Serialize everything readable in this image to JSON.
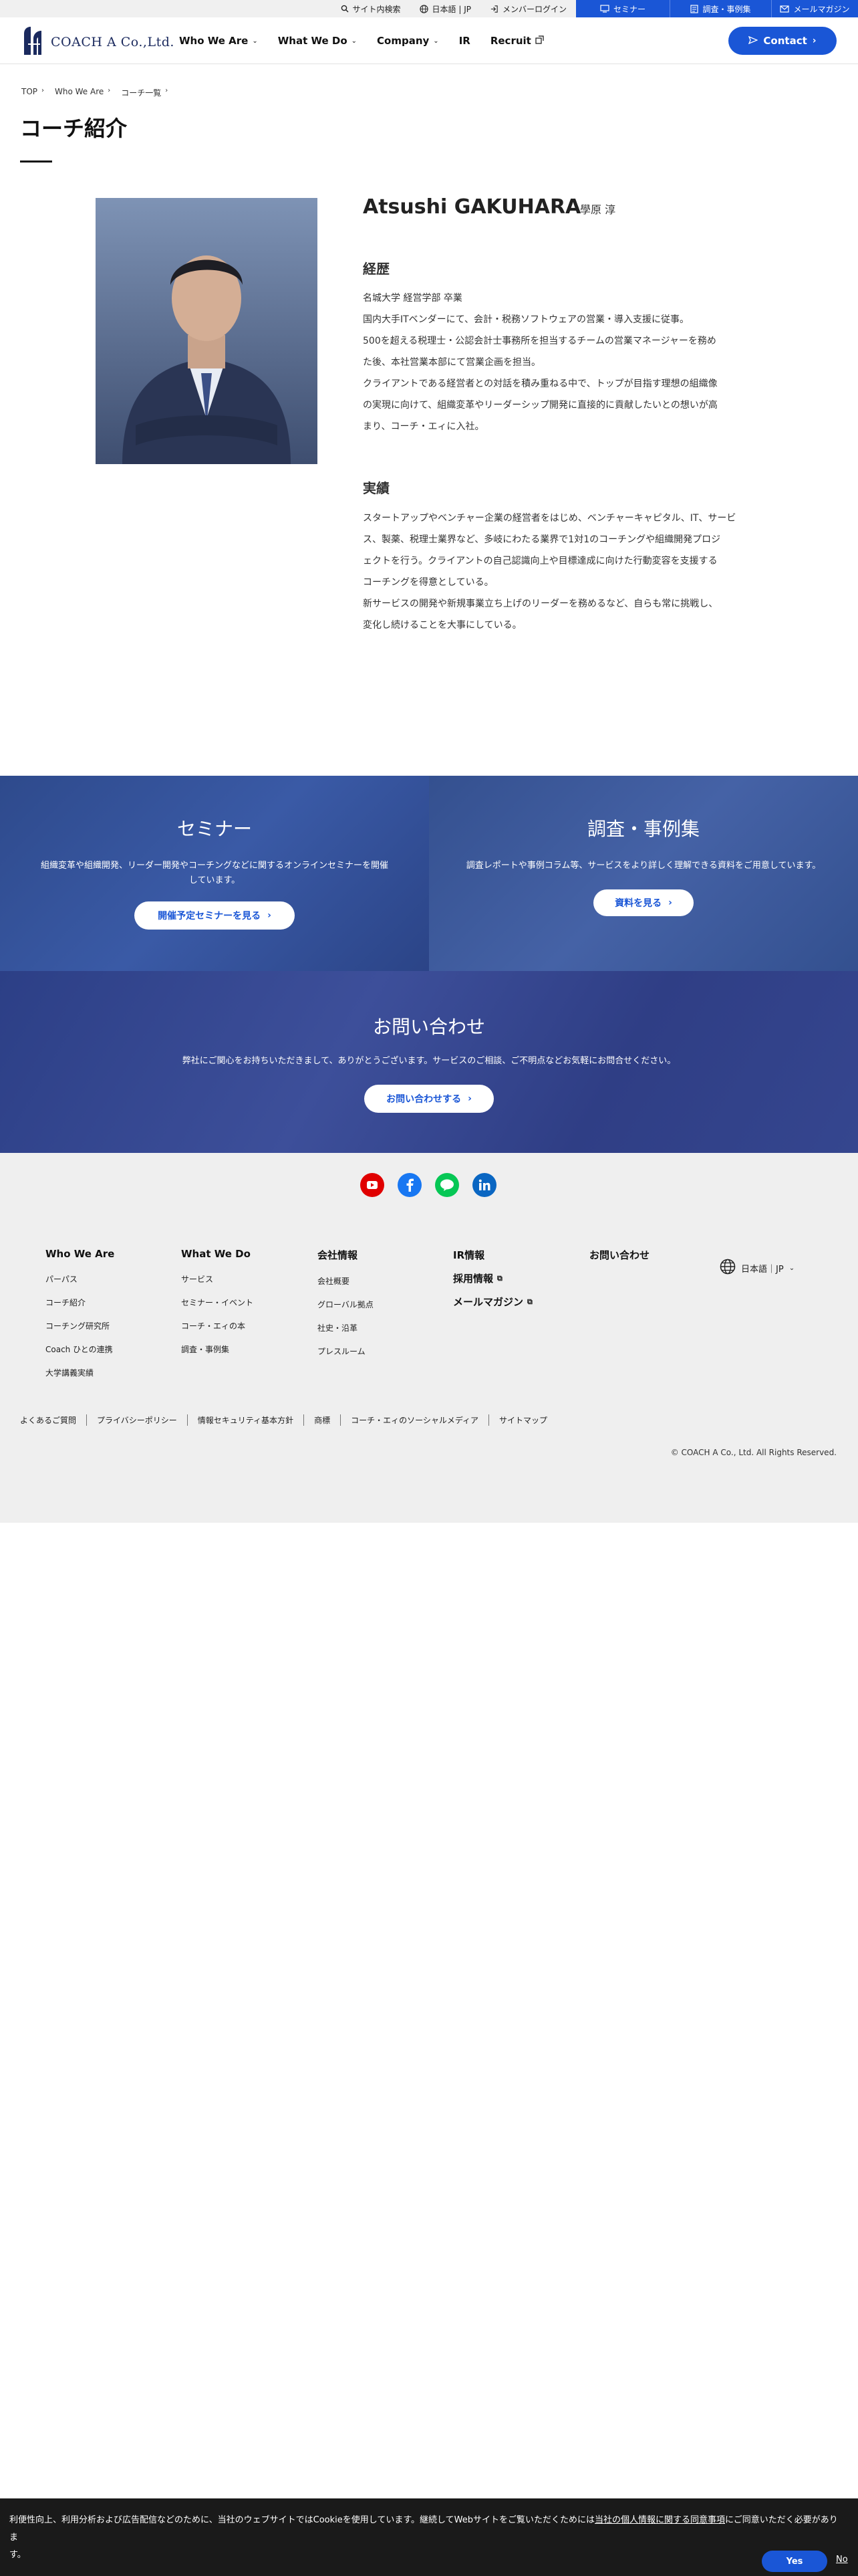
{
  "utility": {
    "search": "サイト内検索",
    "language": "日本語 | JP",
    "login": "メンバーログイン",
    "seminar": "セミナー",
    "research": "調査・事例集",
    "mail": "メールマガジン"
  },
  "header": {
    "logo_text": "COACH A Co.,Ltd.",
    "nav": [
      "Who We Are",
      "What We Do",
      "Company",
      "IR",
      "Recruit"
    ],
    "contact": "Contact"
  },
  "breadcrumb": [
    "TOP",
    "Who We Are",
    "コーチ一覧"
  ],
  "page_title": "コーチ紹介",
  "profile": {
    "name": "Atsushi GAKUHARA",
    "kanji_name": "學原 淳",
    "career_title": "経歴",
    "career_lines": [
      "名城大学 経営学部 卒業",
      "国内大手ITベンダーにて、会計・税務ソフトウェアの営業・導入支援に従事。",
      "500を超える税理士・公認会計士事務所を担当するチームの営業マネージャーを務め",
      "た後、本社営業本部にて営業企画を担当。",
      "クライアントである経営者との対話を積み重ねる中で、トップが目指す理想の組織像",
      "の実現に向けて、組織変革やリーダーシップ開発に直接的に貢献したいとの想いが高",
      "まり、コーチ・エィに入社。"
    ],
    "achievements_title": "実績",
    "achievement_lines": [
      "スタートアップやベンチャー企業の経営者をはじめ、ベンチャーキャピタル、IT、サービ",
      "ス、製薬、税理士業界など、多岐にわたる業界で1対1のコーチングや組織開発プロジ",
      "ェクトを行う。クライアントの自己認識向上や目標達成に向けた行動変容を支援する",
      "コーチングを得意としている。",
      "新サービスの開発や新規事業立ち上げのリーダーを務めるなど、自らも常に挑戦し、",
      "変化し続けることを大事にしている。"
    ]
  },
  "banners": {
    "seminar": {
      "title": "セミナー",
      "desc_line1": "組織変革や組織開発、リーダー開発やコーチングなどに関するオンラインセミナーを開催",
      "desc_line2": "しています。",
      "button": "開催予定セミナーを見る"
    },
    "research": {
      "title": "調査・事例集",
      "desc": "調査レポートや事例コラム等、サービスをより詳しく理解できる資料をご用意しています。",
      "button": "資料を見る"
    },
    "contact": {
      "title": "お問い合わせ",
      "desc": "弊社にご関心をお持ちいただきまして、ありがとうございます。サービスのご相談、ご不明点などお気軽にお問合せください。",
      "button": "お問い合わせする"
    }
  },
  "footer": {
    "social": [
      "youtube-icon",
      "facebook-icon",
      "line-icon",
      "linkedin-icon"
    ],
    "col1": {
      "title": "Who We Are",
      "items": [
        "パーパス",
        "コーチ紹介",
        "コーチング研究所",
        "Coach ひとの連携",
        "大学講義実績"
      ]
    },
    "col2": {
      "title": "What We Do",
      "items": [
        "サービス",
        "セミナー・イベント",
        "コーチ・エィの本",
        "調査・事例集"
      ]
    },
    "col3": {
      "title": "会社情報",
      "items": [
        "会社概要",
        "グローバル拠点",
        "社史・沿革",
        "プレスルーム"
      ]
    },
    "col4": {
      "title": "IR情報",
      "recruit": "採用情報",
      "mailmag": "メールマガジン"
    },
    "col5": {
      "title": "お問い合わせ"
    },
    "language": "日本語｜JP",
    "legal": [
      "よくあるご質問",
      "プライバシーポリシー",
      "情報セキュリティ基本方針",
      "商標",
      "コーチ・エィのソーシャルメディア",
      "サイトマップ"
    ],
    "copyright": "© COACH A Co., Ltd. All Rights Reserved."
  },
  "cookie": {
    "text_before": "利便性向上、利用分析および広告配信などのために、当社のウェブサイトではCookieを使用しています。継続してWebサイトをご覧いただくためには",
    "link": "当社の個人情報に関する同意事項",
    "text_after": "にご同意いただく必要がありま",
    "text_tail": "す。",
    "yes": "Yes",
    "no": "No"
  },
  "colors": {
    "brand_blue": "#1a56d6",
    "navy": "#1b2a5e",
    "footer_bg": "#efefef",
    "cookie_bg": "#1a1a1a"
  }
}
